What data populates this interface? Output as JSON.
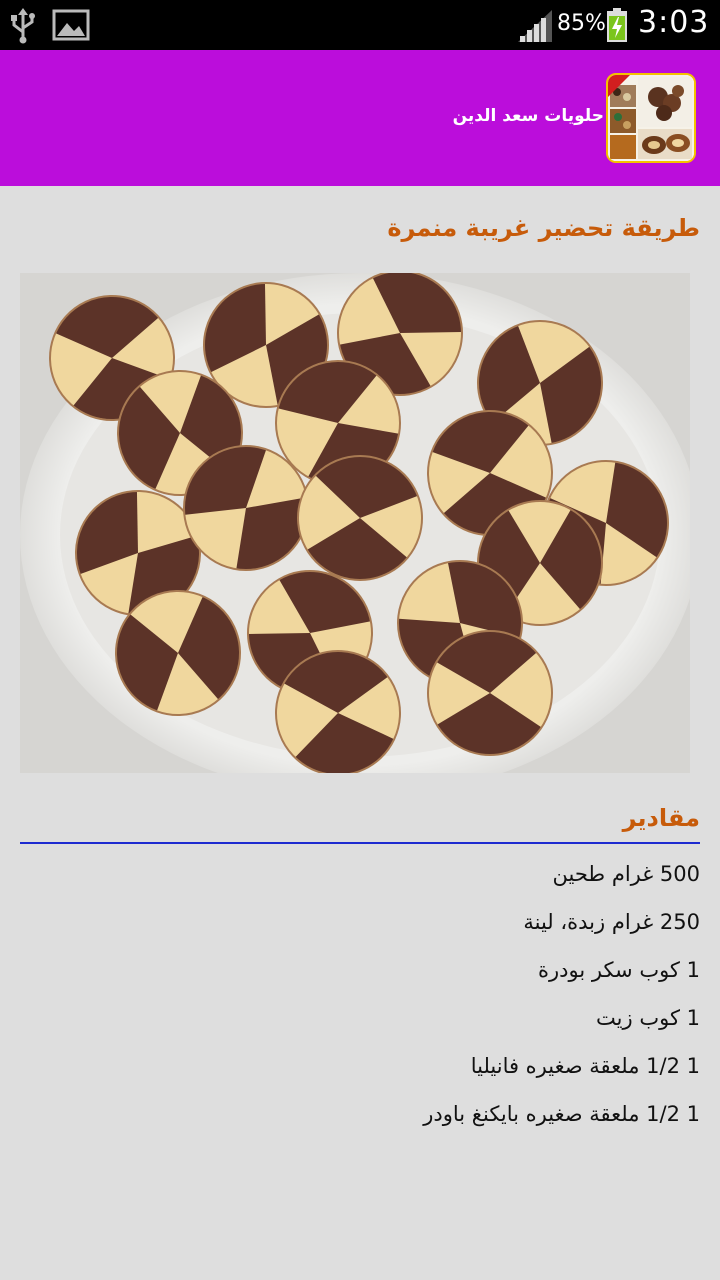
{
  "status_bar": {
    "battery_percent": "85%",
    "time": "3:03",
    "icons": [
      "usb-icon",
      "gallery-icon",
      "signal-icon",
      "battery-charging-icon"
    ]
  },
  "app_bar": {
    "title": "حلويات سعد الدين",
    "background_color": "#bb0ddb",
    "icon": "app-logo-icon"
  },
  "recipe": {
    "title": "طريقة تحضير غريبة منمرة",
    "title_color": "#c75b0a",
    "photo": "two-tone-swirl-cookies-photo"
  },
  "ingredients_section": {
    "title": "مقادير",
    "rule_color": "#1d2bd0",
    "items": [
      "500 غرام طحين",
      "250 غرام زبدة، لينة",
      "1 كوب سكر بودرة",
      "1 كوب زيت",
      "1 1/2 ملعقة صغيره فانيليا",
      "1 1/2 ملعقة صغيره بايكنغ باودر"
    ]
  }
}
